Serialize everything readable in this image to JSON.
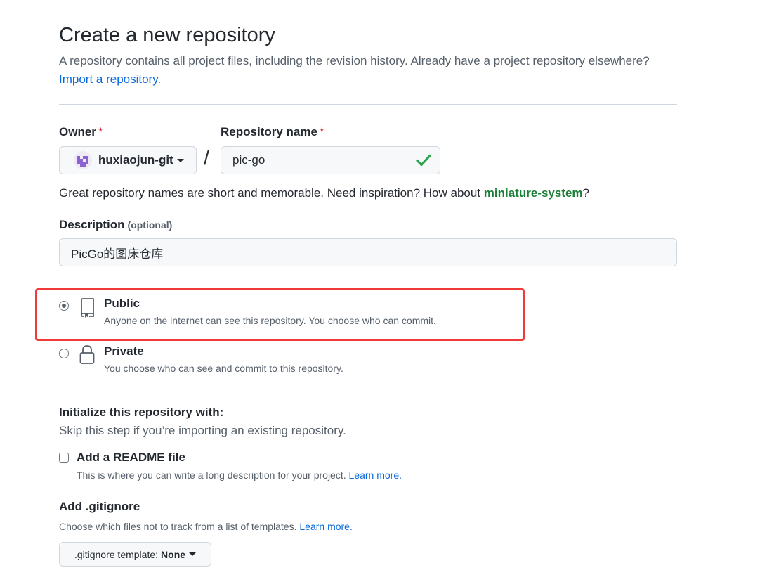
{
  "header": {
    "title": "Create a new repository",
    "subtitle": "A repository contains all project files, including the revision history. Already have a project repository elsewhere?",
    "import_link": "Import a repository."
  },
  "owner": {
    "label": "Owner",
    "required_mark": "*",
    "value": "huxiaojun-git",
    "avatar_icon": "identicon-avatar"
  },
  "repo_name": {
    "label": "Repository name",
    "required_mark": "*",
    "value": "pic-go",
    "separator": "/",
    "valid_icon": "check-icon"
  },
  "name_hint": {
    "text": "Great repository names are short and memorable. Need inspiration? How about ",
    "suggestion": "miniature-system",
    "suffix": "?"
  },
  "description": {
    "label": "Description",
    "optional": "(optional)",
    "value": "PicGo的图床仓库"
  },
  "visibility": {
    "selected": "public",
    "public": {
      "title": "Public",
      "desc": "Anyone on the internet can see this repository. You choose who can commit.",
      "icon": "repo-icon"
    },
    "private": {
      "title": "Private",
      "desc": "You choose who can see and commit to this repository.",
      "icon": "lock-icon"
    }
  },
  "initialize": {
    "title": "Initialize this repository with:",
    "subtitle": "Skip this step if you’re importing an existing repository.",
    "readme": {
      "label": "Add a README file",
      "checked": false,
      "desc": "This is where you can write a long description for your project.",
      "learn_more": "Learn more."
    }
  },
  "gitignore": {
    "title": "Add .gitignore",
    "desc": "Choose which files not to track from a list of templates.",
    "learn_more": "Learn more.",
    "select_prefix": ".gitignore template:",
    "select_value": "None"
  },
  "colors": {
    "link": "#0969da",
    "suggestion": "#1a7f37",
    "required": "#cf222e",
    "highlight_box": "#f03a3a",
    "check": "#2da44e"
  }
}
